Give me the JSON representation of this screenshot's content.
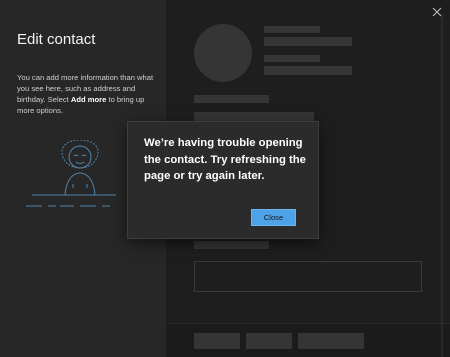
{
  "left_panel": {
    "title": "Edit contact",
    "desc_pre": "You can add more information than what you see here, such as address and birthday. Select ",
    "desc_bold": "Add more",
    "desc_post": " to bring up more options."
  },
  "dialog": {
    "message": "We’re having trouble opening the contact. Try refreshing the page or try again later.",
    "close_label": "Close"
  },
  "icons": {
    "window_close": "close-icon",
    "illustration": "person-illustration"
  },
  "colors": {
    "accent": "#4ea3e8",
    "panel": "#272727",
    "dialog": "#2b2b2b"
  }
}
